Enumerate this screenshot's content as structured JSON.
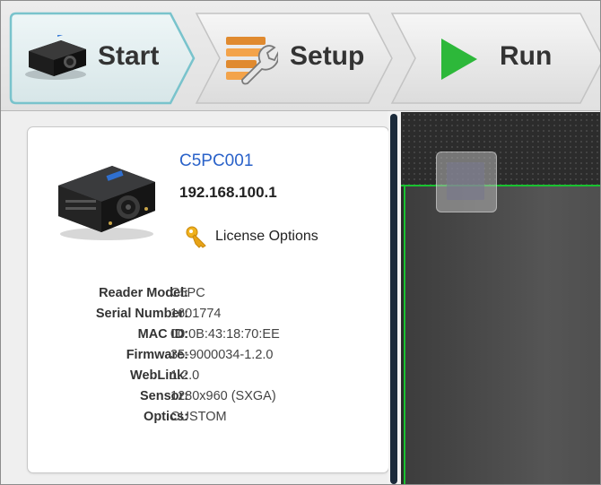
{
  "toolbar": {
    "steps": [
      {
        "label": "Start",
        "icon": "camera-icon",
        "active": true
      },
      {
        "label": "Setup",
        "icon": "setup-icon",
        "active": false
      },
      {
        "label": "Run",
        "icon": "play-icon",
        "active": false
      }
    ]
  },
  "device": {
    "name": "C5PC001",
    "ip": "192.168.100.1",
    "license_label": "License Options",
    "license_icon": "key-icon"
  },
  "info": [
    {
      "key": "Reader Model:",
      "value": "C5PC"
    },
    {
      "key": "Serial Number:",
      "value": "1601774"
    },
    {
      "key": "MAC ID:",
      "value": "00:0B:43:18:70:EE"
    },
    {
      "key": "Firmware:",
      "value": "35-9000034-1.2.0"
    },
    {
      "key": "WebLink:",
      "value": "1.2.0"
    },
    {
      "key": "Sensor:",
      "value": "1280x960 (SXGA)"
    },
    {
      "key": "Optics:",
      "value": "CUSTOM"
    }
  ],
  "colors": {
    "accent": "#2a62c9",
    "active_step": "#e3eef0",
    "active_border": "#7fc6cf",
    "play_green": "#2db83a",
    "roi_line": "#19c130"
  }
}
